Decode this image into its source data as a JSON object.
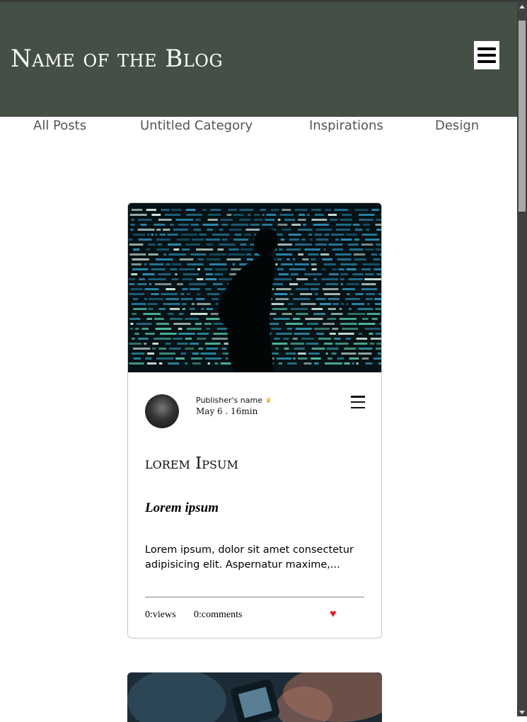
{
  "header": {
    "blog_title": "Name of the Blog",
    "menu_icon": "hamburger-menu-icon"
  },
  "nav": {
    "items": [
      "All Posts",
      "Untitled Category",
      "Inspirations",
      "Design"
    ]
  },
  "post": {
    "publisher": "Publisher's name",
    "publisher_badge_icon": "crown-icon",
    "date_readtime": "May 6 . 16min",
    "title": "lorem Ipsum",
    "subtitle": "Lorem ipsum",
    "excerpt": "Lorem ipsum, dolor sit amet consectetur adipisicing elit. Aspernatur maxime,...",
    "views": "0:views",
    "comments": "0:comments",
    "like_icon": "heart-icon"
  },
  "colors": {
    "header_bg": "#444f45",
    "heart": "#e02030",
    "crown": "#e0a020"
  }
}
